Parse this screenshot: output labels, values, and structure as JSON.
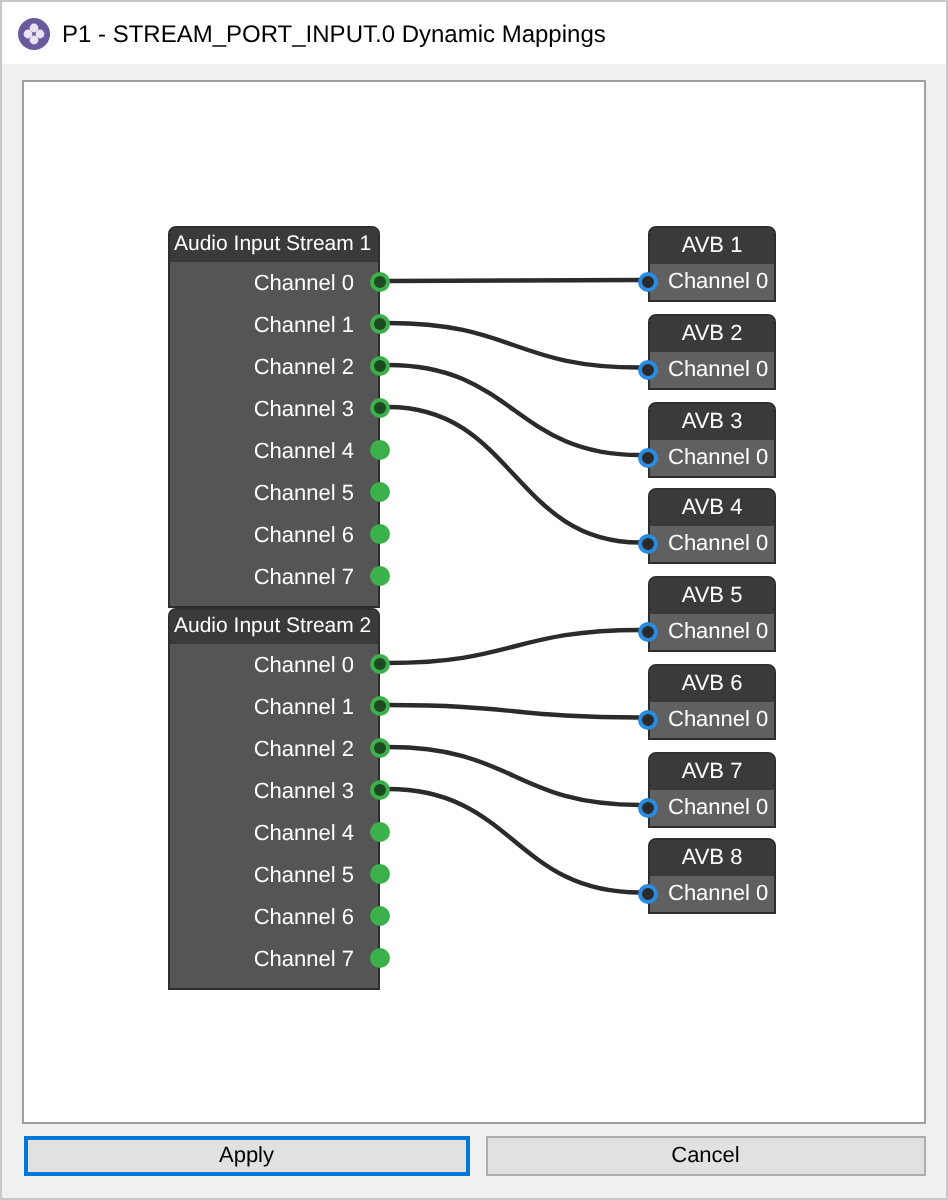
{
  "window": {
    "title": "P1 - STREAM_PORT_INPUT.0 Dynamic Mappings"
  },
  "sources": [
    {
      "title": "Audio Input Stream 1",
      "channels": [
        {
          "label": "Channel 0",
          "connected": true
        },
        {
          "label": "Channel 1",
          "connected": true
        },
        {
          "label": "Channel 2",
          "connected": true
        },
        {
          "label": "Channel 3",
          "connected": true
        },
        {
          "label": "Channel 4",
          "connected": false
        },
        {
          "label": "Channel 5",
          "connected": false
        },
        {
          "label": "Channel 6",
          "connected": false
        },
        {
          "label": "Channel 7",
          "connected": false
        }
      ]
    },
    {
      "title": "Audio Input Stream 2",
      "channels": [
        {
          "label": "Channel 0",
          "connected": true
        },
        {
          "label": "Channel 1",
          "connected": true
        },
        {
          "label": "Channel 2",
          "connected": true
        },
        {
          "label": "Channel 3",
          "connected": true
        },
        {
          "label": "Channel 4",
          "connected": false
        },
        {
          "label": "Channel 5",
          "connected": false
        },
        {
          "label": "Channel 6",
          "connected": false
        },
        {
          "label": "Channel 7",
          "connected": false
        }
      ]
    }
  ],
  "targets": [
    {
      "title": "AVB 1",
      "channel": "Channel 0"
    },
    {
      "title": "AVB 2",
      "channel": "Channel 0"
    },
    {
      "title": "AVB 3",
      "channel": "Channel 0"
    },
    {
      "title": "AVB 4",
      "channel": "Channel 0"
    },
    {
      "title": "AVB 5",
      "channel": "Channel 0"
    },
    {
      "title": "AVB 6",
      "channel": "Channel 0"
    },
    {
      "title": "AVB 7",
      "channel": "Channel 0"
    },
    {
      "title": "AVB 8",
      "channel": "Channel 0"
    }
  ],
  "buttons": [
    {
      "label": "Apply",
      "selected": true
    },
    {
      "label": "Cancel",
      "selected": false
    }
  ]
}
